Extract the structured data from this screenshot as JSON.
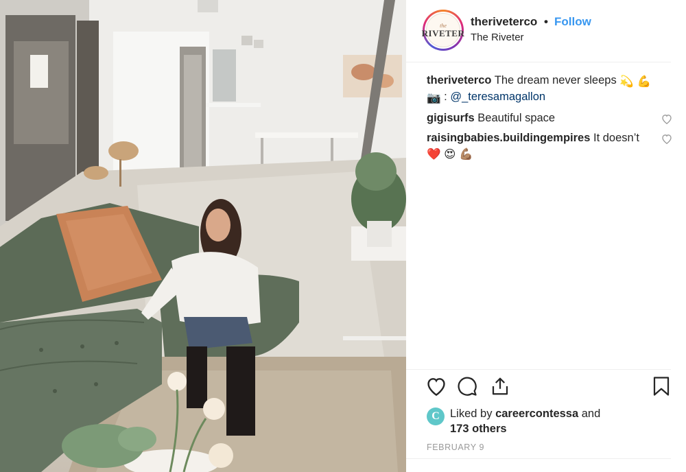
{
  "post": {
    "photo_alt": "",
    "header": {
      "avatar_small": "the",
      "avatar_big": "RIVETER",
      "username": "theriveterco",
      "dot": "•",
      "follow_label": "Follow",
      "location": "The Riveter"
    },
    "caption": {
      "username": "theriveterco",
      "text": "The dream never sleeps",
      "emoji_1": "💫",
      "emoji_2": "💪",
      "camera_emoji": "📷",
      "credit_sep": ":",
      "credit_handle": "@_teresamagallon"
    },
    "comments": [
      {
        "username": "gigisurfs",
        "text": "Beautiful space"
      },
      {
        "username": "raisingbabies.buildingempires",
        "text": "It doesn’t",
        "emojis": [
          "❤️",
          "😍",
          "💪🏽"
        ]
      }
    ],
    "likes": {
      "avatar_letter": "C",
      "prefix": "Liked by",
      "user": "careercontessa",
      "and": "and",
      "others": "173 others"
    },
    "date": "FEBRUARY 9"
  },
  "colors": {
    "link": "#3897f0",
    "text": "#262626",
    "muted": "#999999",
    "divider": "#efefef"
  },
  "icons": [
    "heart-icon",
    "comment-icon",
    "share-icon",
    "bookmark-icon"
  ]
}
